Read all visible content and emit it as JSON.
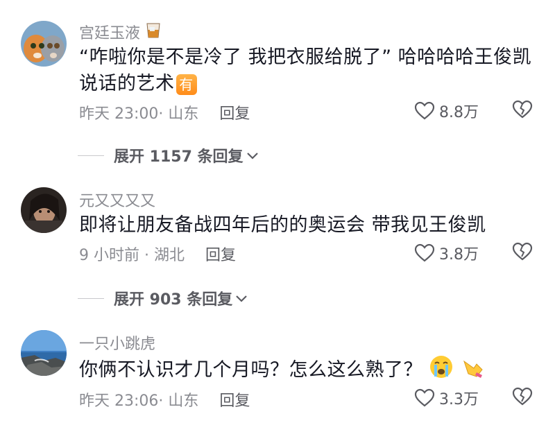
{
  "comments": [
    {
      "username": "宫廷玉液",
      "username_badge_icon": "whiskey-glass-icon",
      "text": "“咋啦你是不是冷了  我把衣服给脱了”   哈哈哈哈王俊凯说话的艺术",
      "text_badge": "有",
      "meta": "昨天 23:00· 山东",
      "reply_label": "回复",
      "likes": "8.8万",
      "expand_label": "展开 1157 条回复"
    },
    {
      "username": "元又又又又",
      "text": "即将让朋友备战四年后的的奥运会  带我见王俊凯",
      "meta": "9 小时前 · 湖北",
      "reply_label": "回复",
      "likes": "3.8万",
      "expand_label": "展开 903 条回复"
    },
    {
      "username": "一只小跳虎",
      "text": "你俩不认识才几个月吗？怎么这么熟了？",
      "text_emojis": [
        "crying-face-icon",
        "pointing-hand-icon"
      ],
      "meta": "昨天 23:06· 山东",
      "reply_label": "回复",
      "likes": "3.3万"
    }
  ],
  "colors": {
    "text": "#161823",
    "muted": "#8a8b91",
    "secondary": "#5a5b61",
    "badge_orange": "#ff8c1a"
  }
}
